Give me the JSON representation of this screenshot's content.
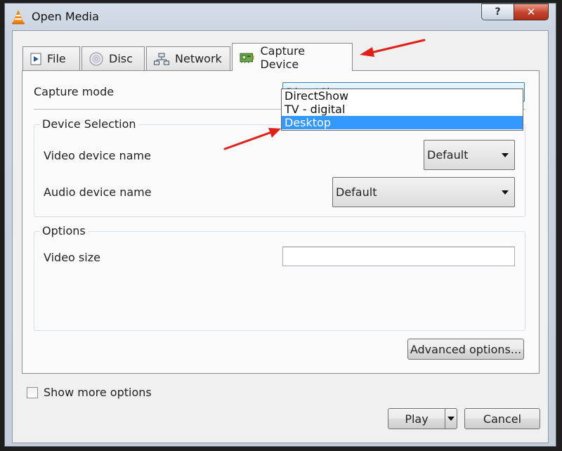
{
  "window": {
    "title": "Open Media",
    "help_label": "?",
    "close_label": "✕"
  },
  "tabs": [
    {
      "label": "File",
      "icon": "file-play-icon"
    },
    {
      "label": "Disc",
      "icon": "disc-icon"
    },
    {
      "label": "Network",
      "icon": "network-icon"
    },
    {
      "label": "Capture Device",
      "icon": "capture-card-icon",
      "active": true
    }
  ],
  "capture": {
    "mode_label": "Capture mode",
    "mode_value": "DirectShow",
    "options": [
      "DirectShow",
      "TV - digital",
      "Desktop"
    ],
    "highlighted_option": "Desktop"
  },
  "device_selection": {
    "title": "Device Selection",
    "video_label": "Video device name",
    "video_value": "Default",
    "audio_label": "Audio device name",
    "audio_value": "Default"
  },
  "options": {
    "title": "Options",
    "video_size_label": "Video size",
    "video_size_value": ""
  },
  "buttons": {
    "advanced": "Advanced options...",
    "play": "Play",
    "cancel": "Cancel"
  },
  "show_more": {
    "label": "Show more options",
    "checked": false
  },
  "colors": {
    "annotation_arrow": "#e0201a",
    "selection": "#3399ff",
    "close_button": "#c4422c"
  }
}
